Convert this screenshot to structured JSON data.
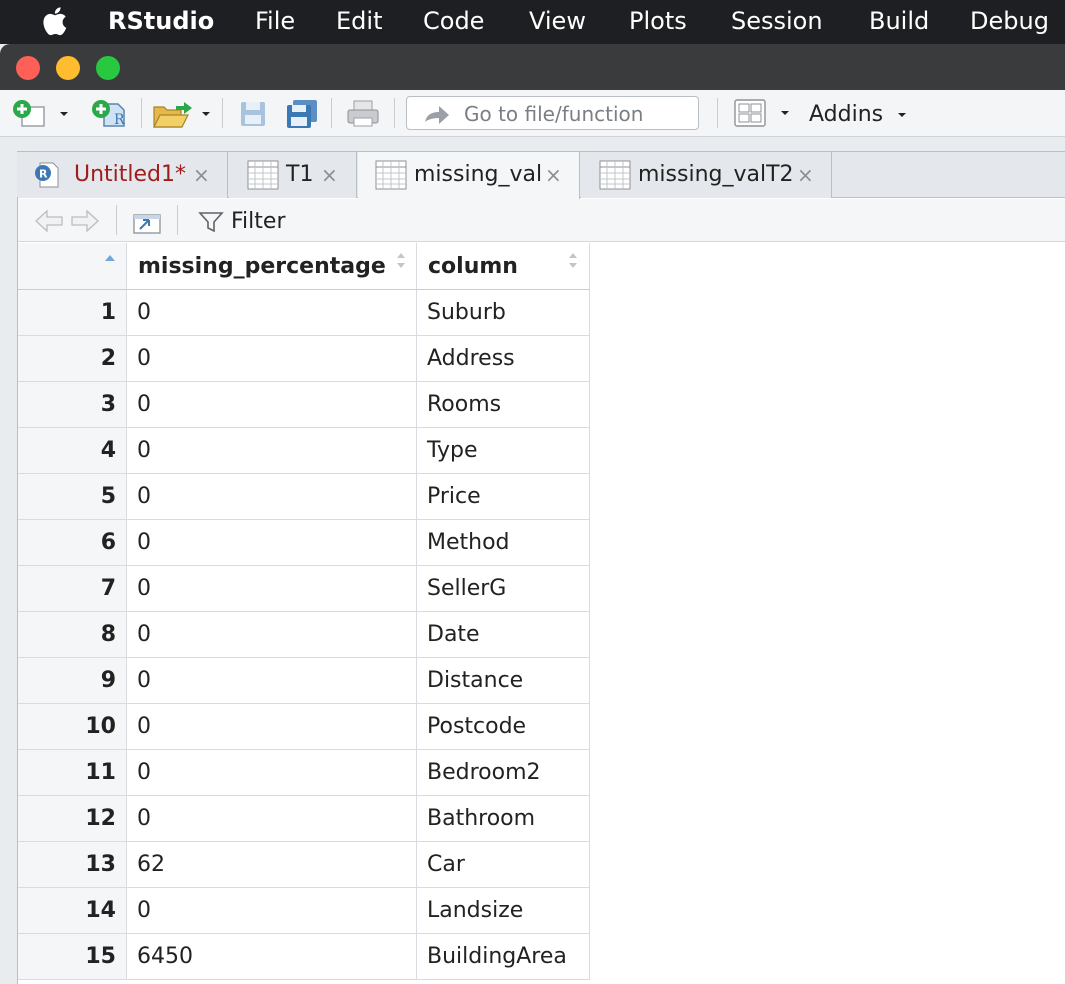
{
  "menubar": {
    "app": "RStudio",
    "items": [
      "File",
      "Edit",
      "Code",
      "View",
      "Plots",
      "Session",
      "Build",
      "Debug"
    ]
  },
  "toolbar": {
    "goto_placeholder": "Go to file/function",
    "addins": "Addins"
  },
  "tabs": [
    {
      "label": "Untitled1*",
      "close": "×",
      "color": "#a11d1d"
    },
    {
      "label": "T1",
      "close": "×"
    },
    {
      "label": "missing_val",
      "close": "×"
    },
    {
      "label": "missing_valT2",
      "close": "×"
    }
  ],
  "viewer": {
    "filter_label": "Filter"
  },
  "table": {
    "columns": [
      "missing_percentage",
      "column"
    ],
    "rows": [
      {
        "idx": "1",
        "missing_percentage": "0",
        "column": "Suburb"
      },
      {
        "idx": "2",
        "missing_percentage": "0",
        "column": "Address"
      },
      {
        "idx": "3",
        "missing_percentage": "0",
        "column": "Rooms"
      },
      {
        "idx": "4",
        "missing_percentage": "0",
        "column": "Type"
      },
      {
        "idx": "5",
        "missing_percentage": "0",
        "column": "Price"
      },
      {
        "idx": "6",
        "missing_percentage": "0",
        "column": "Method"
      },
      {
        "idx": "7",
        "missing_percentage": "0",
        "column": "SellerG"
      },
      {
        "idx": "8",
        "missing_percentage": "0",
        "column": "Date"
      },
      {
        "idx": "9",
        "missing_percentage": "0",
        "column": "Distance"
      },
      {
        "idx": "10",
        "missing_percentage": "0",
        "column": "Postcode"
      },
      {
        "idx": "11",
        "missing_percentage": "0",
        "column": "Bedroom2"
      },
      {
        "idx": "12",
        "missing_percentage": "0",
        "column": "Bathroom"
      },
      {
        "idx": "13",
        "missing_percentage": "62",
        "column": "Car"
      },
      {
        "idx": "14",
        "missing_percentage": "0",
        "column": "Landsize"
      },
      {
        "idx": "15",
        "missing_percentage": "6450",
        "column": "BuildingArea"
      }
    ]
  },
  "colors": {
    "menubar": "#1e1f22",
    "titlebar": "#3a3b3d",
    "close_light": "#fe5f57",
    "minimize_light": "#febc2e",
    "zoom_light": "#28c840",
    "accent_green": "#2aa84a",
    "accent_blue": "#3c78b4"
  }
}
